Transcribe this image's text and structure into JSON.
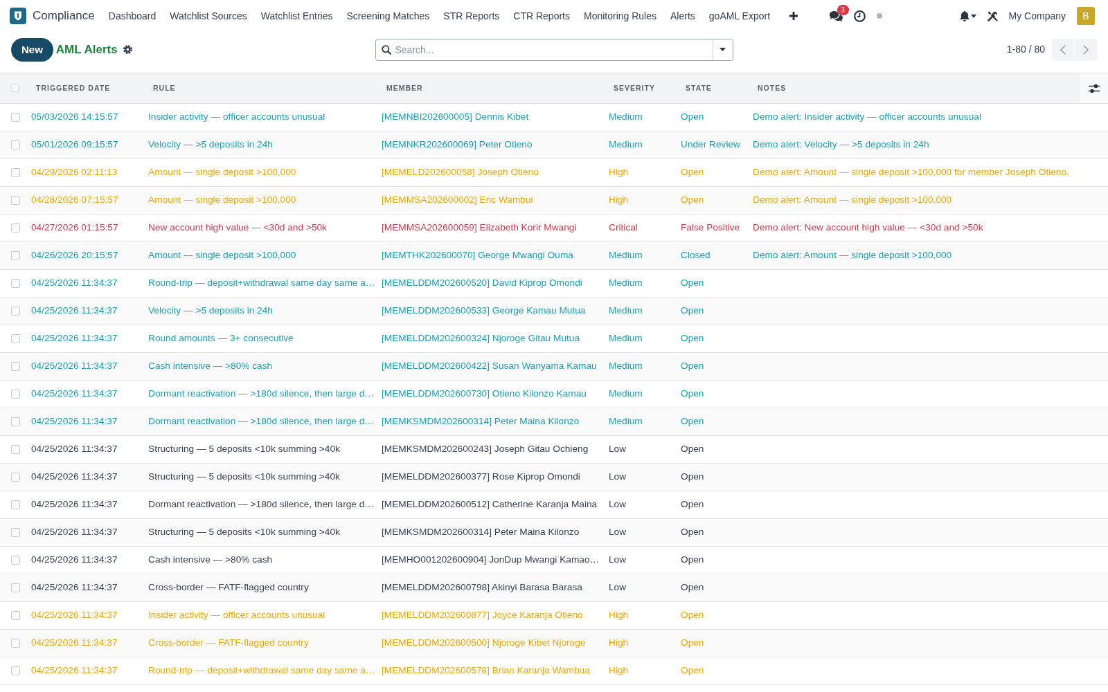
{
  "navbar": {
    "app_name": "Compliance",
    "menu": [
      "Dashboard",
      "Watchlist Sources",
      "Watchlist Entries",
      "Screening Matches",
      "STR Reports",
      "CTR Reports",
      "Monitoring Rules",
      "Alerts",
      "goAML Export"
    ],
    "message_count": "3",
    "company": "My Company",
    "avatar_initial": "B"
  },
  "control_panel": {
    "new_button": "New",
    "title": "AML Alerts",
    "search": {
      "placeholder": "Search..."
    },
    "pager": "1-80 / 80"
  },
  "table": {
    "select_all": {
      "checked": false
    },
    "columns": [
      "TRIGGERED DATE",
      "RULE",
      "MEMBER",
      "SEVERITY",
      "STATE",
      "NOTES"
    ],
    "rows": [
      {
        "checked": false,
        "color": "#1b9db1",
        "triggered_date": "05/03/2026 14:15:57",
        "rule": "Insider activity — officer accounts unusual",
        "member": "[MEMNBI202600005] Dennis Kibet",
        "severity": "Medium",
        "state": "Open",
        "notes": "Demo alert: Insider activity — officer accounts unusual"
      },
      {
        "checked": false,
        "color": "#1b9db1",
        "triggered_date": "05/01/2026 09:15:57",
        "rule": "Velocity — >5 deposits in 24h",
        "member": "[MEMNKR202600069] Peter Otieno",
        "severity": "Medium",
        "state": "Under Review",
        "notes": "Demo alert: Velocity — >5 deposits in 24h"
      },
      {
        "checked": false,
        "color": "#eda600",
        "triggered_date": "04/29/2026 02:11:13",
        "rule": "Amount — single deposit >100,000",
        "member": "[MEMELD202600058] Joseph Otieno",
        "severity": "High",
        "state": "Open",
        "notes": "Demo alert: Amount — single deposit >100,000 for member Joseph Otieno."
      },
      {
        "checked": false,
        "color": "#eda600",
        "triggered_date": "04/28/2026 07:15:57",
        "rule": "Amount — single deposit >100,000",
        "member": "[MEMMSA202600002] Eric Wambui",
        "severity": "High",
        "state": "Open",
        "notes": "Demo alert: Amount — single deposit >100,000"
      },
      {
        "checked": false,
        "color": "#cc3a4d",
        "triggered_date": "04/27/2026 01:15:57",
        "rule": "New account high value — <30d and >50k",
        "member": "[MEMMSA202600059] Elizabeth Korir Mwangi",
        "severity": "Critical",
        "state": "False Positive",
        "notes": "Demo alert: New account high value — <30d and >50k"
      },
      {
        "checked": false,
        "color": "#1b9db1",
        "triggered_date": "04/26/2026 20:15:57",
        "rule": "Amount — single deposit >100,000",
        "member": "[MEMTHK202600070] George Mwangi Ouma",
        "severity": "Medium",
        "state": "Closed",
        "notes": "Demo alert: Amount — single deposit >100,000"
      },
      {
        "checked": false,
        "color": "#1b9db1",
        "triggered_date": "04/25/2026 11:34:37",
        "rule": "Round-trip — deposit+withdrawal same day same a…",
        "member": "[MEMELDDM202600520] David Kiprop Omondi",
        "severity": "Medium",
        "state": "Open"
      },
      {
        "checked": false,
        "color": "#1b9db1",
        "triggered_date": "04/25/2026 11:34:37",
        "rule": "Velocity — >5 deposits in 24h",
        "member": "[MEMELDDM202600533] George Kamau Mutua",
        "severity": "Medium",
        "state": "Open"
      },
      {
        "checked": false,
        "color": "#1b9db1",
        "triggered_date": "04/25/2026 11:34:37",
        "rule": "Round amounts — 3+ consecutive",
        "member": "[MEMELDDM202600324] Njoroge Gitau Mutua",
        "severity": "Medium",
        "state": "Open"
      },
      {
        "checked": false,
        "color": "#1b9db1",
        "triggered_date": "04/25/2026 11:34:37",
        "rule": "Cash intensive — >80% cash",
        "member": "[MEMELDDM202600422] Susan Wanyama Kamau",
        "severity": "Medium",
        "state": "Open"
      },
      {
        "checked": false,
        "color": "#1b9db1",
        "triggered_date": "04/25/2026 11:34:37",
        "rule": "Dormant reactivation — >180d silence, then large d…",
        "member": "[MEMELDDM202600730] Otieno Kilonzo Kamau",
        "severity": "Medium",
        "state": "Open"
      },
      {
        "checked": false,
        "color": "#1b9db1",
        "triggered_date": "04/25/2026 11:34:37",
        "rule": "Dormant reactivation — >180d silence, then large d…",
        "member": "[MEMKSMDM202600314] Peter Maina Kilonzo",
        "severity": "Medium",
        "state": "Open"
      },
      {
        "checked": false,
        "color": "#374151",
        "triggered_date": "04/25/2026 11:34:37",
        "rule": "Structuring — 5 deposits <10k summing >40k",
        "member": "[MEMKSMDM202600243] Joseph Gitau Ochieng",
        "severity": "Low",
        "state": "Open"
      },
      {
        "checked": false,
        "color": "#374151",
        "triggered_date": "04/25/2026 11:34:37",
        "rule": "Structuring — 5 deposits <10k summing >40k",
        "member": "[MEMELDDM202600377] Rose Kiprop Omondi",
        "severity": "Low",
        "state": "Open"
      },
      {
        "checked": false,
        "color": "#374151",
        "triggered_date": "04/25/2026 11:34:37",
        "rule": "Dormant reactivation — >180d silence, then large d…",
        "member": "[MEMELDDM202600512] Catherine Karanja Maina",
        "severity": "Low",
        "state": "Open"
      },
      {
        "checked": false,
        "color": "#374151",
        "triggered_date": "04/25/2026 11:34:37",
        "rule": "Structuring — 5 deposits <10k summing >40k",
        "member": "[MEMKSMDM202600314] Peter Maina Kilonzo",
        "severity": "Low",
        "state": "Open"
      },
      {
        "checked": false,
        "color": "#374151",
        "triggered_date": "04/25/2026 11:34:37",
        "rule": "Cash intensive — >80% cash",
        "member": "[MEMHO001202600904] JonDup Mwangi Kamao…",
        "severity": "Low",
        "state": "Open"
      },
      {
        "checked": false,
        "color": "#374151",
        "triggered_date": "04/25/2026 11:34:37",
        "rule": "Cross-border — FATF-flagged country",
        "member": "[MEMELDDM202600798] Akinyi Barasa Barasa",
        "severity": "Low",
        "state": "Open"
      },
      {
        "checked": false,
        "color": "#eda600",
        "triggered_date": "04/25/2026 11:34:37",
        "rule": "Insider activity — officer accounts unusual",
        "member": "[MEMELDDM202600877] Joyce Karanja Otieno",
        "severity": "High",
        "state": "Open"
      },
      {
        "checked": false,
        "color": "#eda600",
        "triggered_date": "04/25/2026 11:34:37",
        "rule": "Cross-border — FATF-flagged country",
        "member": "[MEMELDDM202600500] Njoroge Kibet Njoroge",
        "severity": "High",
        "state": "Open"
      },
      {
        "checked": false,
        "color": "#eda600",
        "triggered_date": "04/25/2026 11:34:37",
        "rule": "Round-trip — deposit+withdrawal same day same a…",
        "member": "[MEMELDDM202600578] Brian Karanja Wambua",
        "severity": "High",
        "state": "Open"
      }
    ]
  }
}
